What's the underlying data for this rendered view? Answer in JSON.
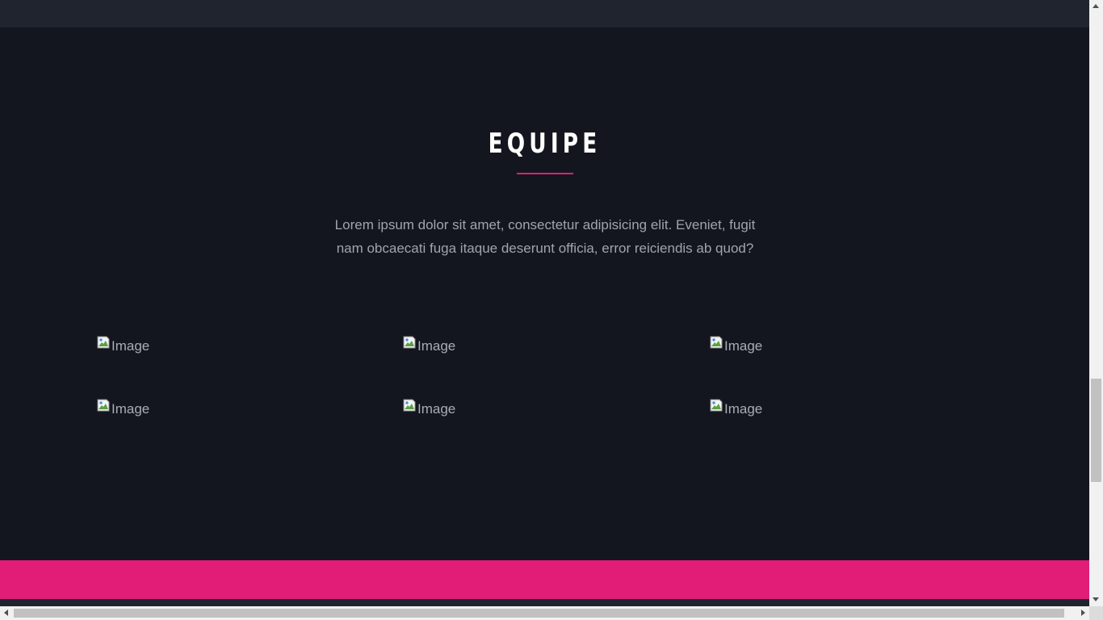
{
  "colors": {
    "accent": "#e11d78",
    "page_background": "#13161e",
    "header_background": "#1f242e"
  },
  "team": {
    "title": "EQUIPE",
    "description": "Lorem ipsum dolor sit amet, consectetur adipisicing elit. Eveniet, fugit nam obcaecati fuga itaque deserunt officia, error reiciendis ab quod?",
    "members": [
      {
        "image_alt": "Image",
        "icon": "broken-image-icon"
      },
      {
        "image_alt": "Image",
        "icon": "broken-image-icon"
      },
      {
        "image_alt": "Image",
        "icon": "broken-image-icon"
      },
      {
        "image_alt": "Image",
        "icon": "broken-image-icon"
      },
      {
        "image_alt": "Image",
        "icon": "broken-image-icon"
      },
      {
        "image_alt": "Image",
        "icon": "broken-image-icon"
      }
    ]
  },
  "scrollbars": {
    "vertical_icon_up": "chevron-up-icon",
    "vertical_icon_down": "chevron-down-icon",
    "horizontal_icon_left": "chevron-left-icon",
    "horizontal_icon_right": "chevron-right-icon"
  }
}
